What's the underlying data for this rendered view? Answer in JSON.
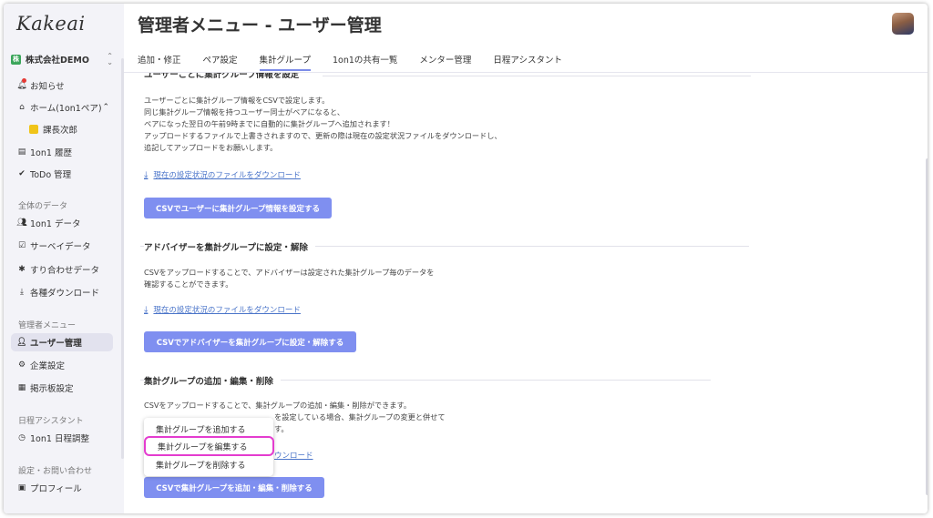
{
  "app": {
    "logo": "Kakeai",
    "title": "管理者メニュー - ユーザー管理"
  },
  "sidebar": {
    "company": {
      "badge": "株",
      "name": "株式会社DEMO",
      "arrows": "⌃⌄"
    },
    "items_top": [
      {
        "label": "お知らせ",
        "icon": "bell-icon"
      },
      {
        "label": "ホーム(1on1ペア)",
        "icon": "home-icon",
        "chevron": "⌃"
      },
      {
        "label": "課長次郎",
        "icon": "person-badge-icon"
      },
      {
        "label": "1on1 履歴",
        "icon": "history-icon"
      },
      {
        "label": "ToDo 管理",
        "icon": "check-circle-icon"
      }
    ],
    "group_all": {
      "heading": "全体のデータ",
      "items": [
        "1on1 データ",
        "サーベイデータ",
        "すり合わせデータ",
        "各種ダウンロード"
      ]
    },
    "group_admin": {
      "heading": "管理者メニュー",
      "items": [
        "ユーザー管理",
        "企業設定",
        "掲示板設定"
      ]
    },
    "group_schedule": {
      "heading": "日程アシスタント",
      "items": [
        "1on1 日程調整"
      ]
    },
    "group_settings": {
      "heading": "設定・お問い合わせ",
      "items": [
        "プロフィール"
      ]
    }
  },
  "tabs": [
    "追加・修正",
    "ペア設定",
    "集計グループ",
    "1on1の共有一覧",
    "メンター管理",
    "日程アシスタント"
  ],
  "active_tab": "集計グループ",
  "section1": {
    "title": "ユーザーごとに集計グループ情報を設定",
    "lines": [
      "ユーザーごとに集計グループ情報をCSVで設定します。",
      "同じ集計グループ情報を持つユーザー同士がペアになると、",
      "ペアになった翌日の午前9時までに自動的に集計グループへ追加されます！",
      "アップロードするファイルで上書きされますので、更新の際は現在の設定状況ファイルをダウンロードし、",
      "追記してアップロードをお願いします。"
    ],
    "download": "現在の設定状況のファイルをダウンロード",
    "button": "CSVでユーザーに集計グループ情報を設定する"
  },
  "section2": {
    "title": "アドバイザーを集計グループに設定・解除",
    "lines": [
      "CSVをアップロードすることで、アドバイザーは設定された集計グループ毎のデータを",
      "確認することができます。"
    ],
    "download": "現在の設定状況のファイルをダウンロード",
    "button": "CSVでアドバイザーを集計グループに設定・解除する"
  },
  "section3": {
    "title": "集計グループの追加・編集・削除",
    "line1": "CSVをアップロードすることで、集計グループの追加・編集・削除ができます。",
    "line2_tail": "を設定している場合、集計グループの変更と併せて",
    "line3_tail": "す。",
    "download_tail": "ウンロード",
    "button": "CSVで集計グループを追加・編集・削除する"
  },
  "dropdown": {
    "items": [
      "集計グループを追加する",
      "集計グループを編集する",
      "集計グループを削除する"
    ],
    "highlighted": "集計グループを編集する"
  },
  "colors": {
    "accent": "#7f8ff0",
    "link": "#4a74c9",
    "highlight": "#e43ccf"
  }
}
